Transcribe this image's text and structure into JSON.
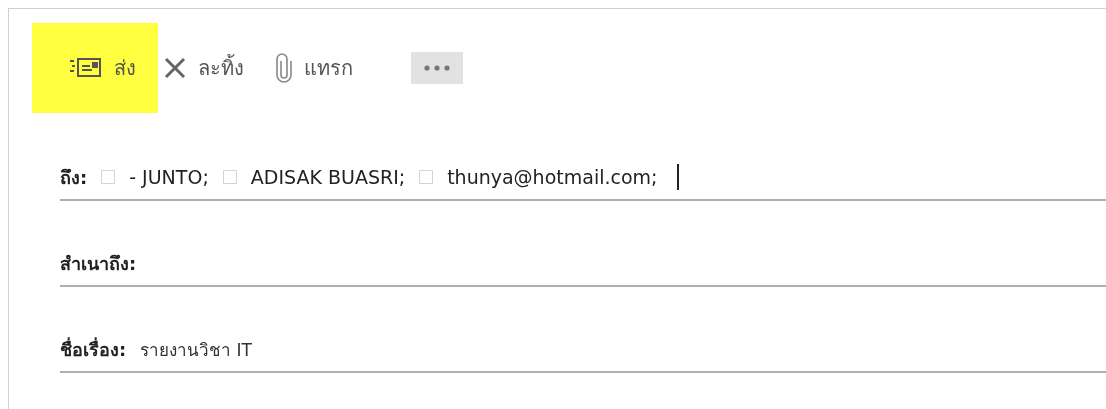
{
  "toolbar": [
    {
      "kind": "send",
      "label": "ส่ง",
      "highlighted": true
    },
    {
      "kind": "discard",
      "label": "ละทิ้ง",
      "highlighted": false
    },
    {
      "kind": "attach",
      "label": "แทรก",
      "highlighted": false
    },
    {
      "kind": "more",
      "highlighted": false
    }
  ],
  "to": {
    "label": "ถึง:",
    "recipients": [
      {
        "name": "- JUNTO;",
        "checked": false
      },
      {
        "name": "ADISAK BUASRI;",
        "checked": false
      },
      {
        "name": "thunya@hotmail.com;",
        "checked": false
      }
    ]
  },
  "cc": {
    "label": "สำเนาถึง:"
  },
  "subject": {
    "label": "ชื่อเรื่อง:",
    "value": "รายงานวิชา IT"
  }
}
